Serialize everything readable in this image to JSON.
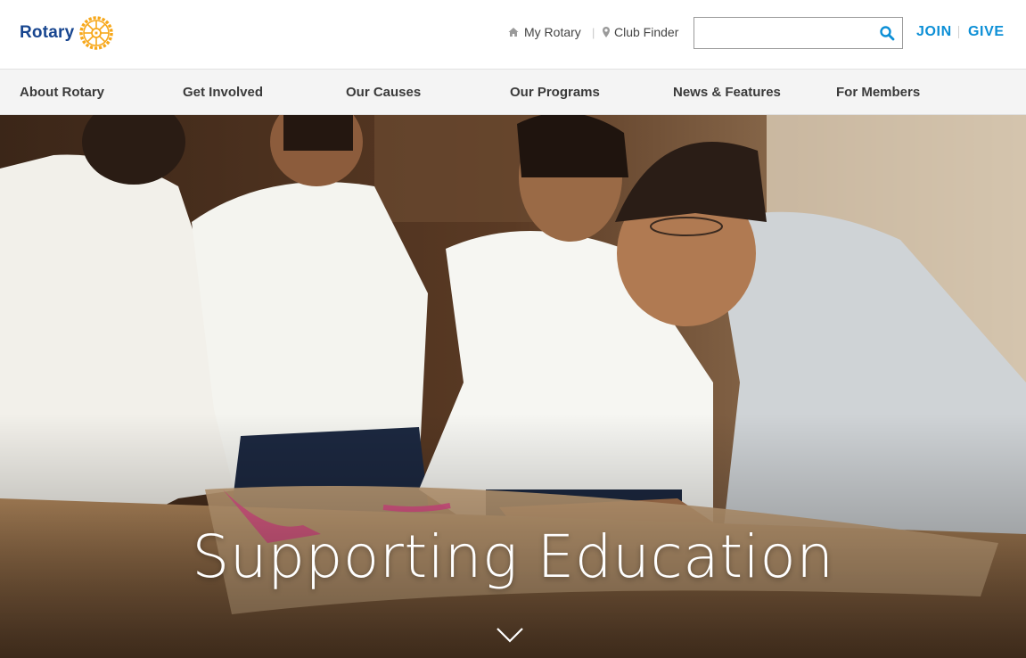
{
  "header": {
    "logo_text": "Rotary",
    "utility_links": {
      "my_rotary": "My Rotary",
      "separator": "|",
      "club_finder": "Club Finder"
    },
    "search": {
      "placeholder": "",
      "value": ""
    },
    "join_label": "JOIN",
    "give_label": "GIVE"
  },
  "nav": {
    "items": [
      {
        "label": "About Rotary"
      },
      {
        "label": "Get Involved"
      },
      {
        "label": "Our Causes"
      },
      {
        "label": "Our Programs"
      },
      {
        "label": "News & Features"
      },
      {
        "label": "For Members"
      }
    ]
  },
  "hero": {
    "title": "Supporting Education"
  },
  "icons": {
    "logo": "rotary-wheel-icon",
    "my_rotary": "home-icon",
    "club_finder": "map-pin-icon",
    "search": "search-icon",
    "scroll": "chevron-down-icon"
  },
  "colors": {
    "brand_blue": "#17458f",
    "brand_gold": "#f7a81b",
    "cta_blue": "#0c8fd6",
    "nav_background": "#f4f4f4"
  }
}
